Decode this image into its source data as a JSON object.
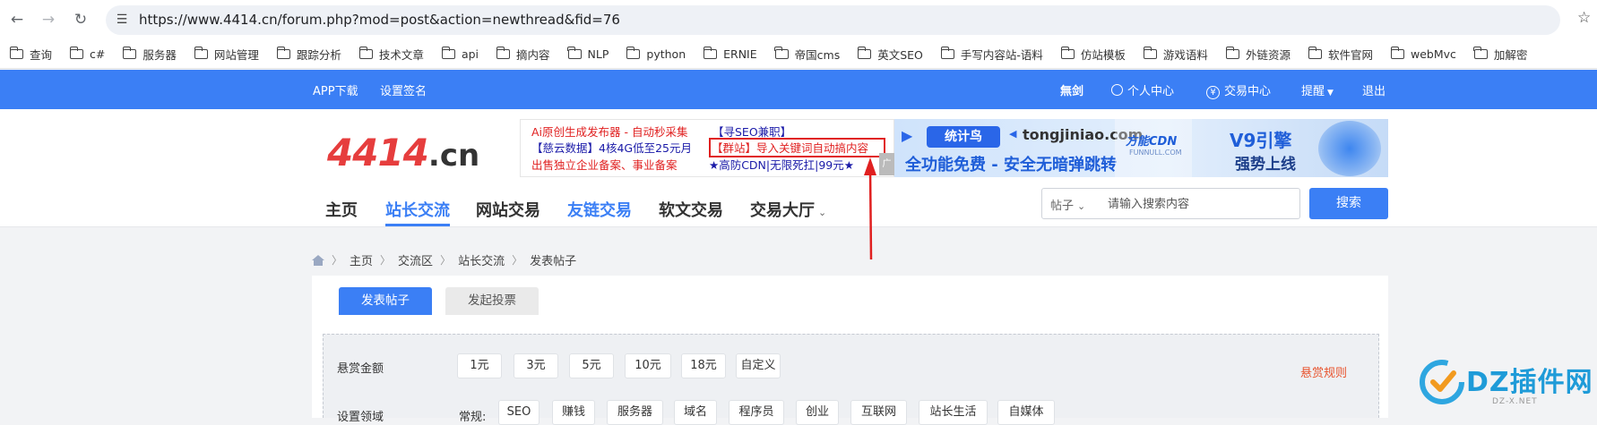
{
  "browser": {
    "url": "https://www.4414.cn/forum.php?mod=post&action=newthread&fid=76",
    "bookmarks": [
      "查询",
      "c#",
      "服务器",
      "网站管理",
      "跟踪分析",
      "技术文章",
      "api",
      "摘内容",
      "NLP",
      "python",
      "ERNIE",
      "帝国cms",
      "英文SEO",
      "手写内容站-语料",
      "仿站模板",
      "游戏语料",
      "外链资源",
      "软件官网",
      "webMvc",
      "加解密"
    ]
  },
  "topbar": {
    "app_download": "APP下载",
    "set_signature": "设置签名",
    "username": "無剑",
    "personal_center": "个人中心",
    "trade_center": "交易中心",
    "reminder": "提醒",
    "logout": "退出"
  },
  "logo": {
    "main": "4414",
    "suffix": ".cn"
  },
  "ad": {
    "line1a": "Ai原创生成发布器 - 自动秒采集",
    "line1b": "【寻SEO兼职】",
    "line2a": "【慈云数据】4核4G低至25元月",
    "line2b": "【群站】导入关键词自动搞内容",
    "line3a": "出售独立企业备案、事业备案",
    "line3b": "★高防CDN|无限死扛|99元★",
    "tag": "广告",
    "banner_brand": "统计鸟",
    "banner_domain": "tongjiniao.com",
    "banner_slogan": "全功能免费 - 安全无暗弹跳转",
    "banner_cdn": "方能CDN",
    "banner_cdn_sub": "FUNNULL.COM",
    "banner_v9": "V9引擎",
    "banner_v9_sub": "强势上线"
  },
  "mainnav": {
    "items": [
      "主页",
      "站长交流",
      "网站交易",
      "友链交易",
      "软文交易",
      "交易大厅"
    ]
  },
  "search": {
    "type": "帖子",
    "placeholder": "请输入搜索内容",
    "button": "搜索"
  },
  "breadcrumb": [
    "主页",
    "交流区",
    "站长交流",
    "发表帖子"
  ],
  "tabs": {
    "post": "发表帖子",
    "vote": "发起投票"
  },
  "form": {
    "reward_label": "悬赏金额",
    "reward_options": [
      "1元",
      "3元",
      "5元",
      "10元",
      "18元",
      "自定义"
    ],
    "rules_link": "悬赏规则",
    "domain_label": "设置领域",
    "domain_group": "常规:",
    "domain_options": [
      "SEO",
      "赚钱",
      "服务器",
      "域名",
      "程序员",
      "创业",
      "互联网",
      "站长生活",
      "自媒体"
    ]
  },
  "watermark": {
    "text": "DZ插件网",
    "sub": "DZ-X.NET"
  },
  "colors": {
    "primary": "#3b7ff5",
    "logo_red": "#e63d3d",
    "warning": "#e8532d"
  }
}
